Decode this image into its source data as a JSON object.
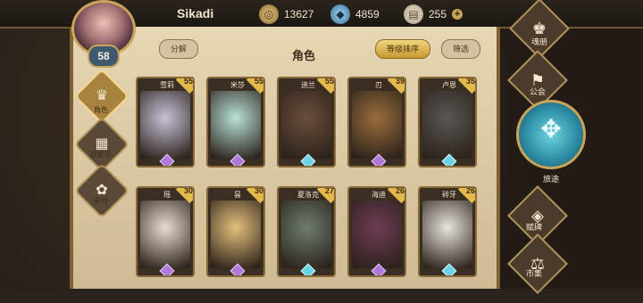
{
  "player": {
    "name": "Sikadi",
    "level": "58"
  },
  "currencies": [
    {
      "icon": "gold-coin-icon",
      "value": "13627"
    },
    {
      "icon": "blue-crystal-icon",
      "value": "4859"
    },
    {
      "icon": "scroll-icon",
      "value": "255"
    }
  ],
  "panel": {
    "title": "角色",
    "decompose_label": "分解",
    "sort_label": "等级排序",
    "filter_label": "筛选"
  },
  "side_tabs": [
    {
      "label": "角色",
      "icon": "crown-icon",
      "active": true
    },
    {
      "label": "技能书",
      "icon": "book-icon",
      "active": false
    },
    {
      "label": "素材",
      "icon": "pouch-icon",
      "active": false
    }
  ],
  "right_menu": [
    {
      "label": "魂册",
      "icon": "crown-icon"
    },
    {
      "label": "公会",
      "icon": "guild-flag-icon"
    },
    {
      "label": "旅途",
      "icon": "compass-icon"
    },
    {
      "label": "赋碑",
      "icon": "stone-icon"
    },
    {
      "label": "市集",
      "icon": "market-icon"
    }
  ],
  "heroes": [
    {
      "name": "雪莉",
      "level": "55",
      "gem": "purple",
      "art": "#c9c2d8"
    },
    {
      "name": "米莎",
      "level": "55",
      "gem": "purple",
      "art": "#b9e1d7"
    },
    {
      "name": "迪兰",
      "level": "55",
      "gem": "cyan",
      "art": "#6a4e3a"
    },
    {
      "name": "刃",
      "level": "39",
      "gem": "purple",
      "art": "#9a6e3c"
    },
    {
      "name": "卢恩",
      "level": "35",
      "gem": "cyan",
      "art": "#5b5754"
    },
    {
      "name": "瑶",
      "level": "30",
      "gem": "purple",
      "art": "#e8ddd0"
    },
    {
      "name": "昙",
      "level": "30",
      "gem": "purple",
      "art": "#e4c07b"
    },
    {
      "name": "夏洛克",
      "level": "27",
      "gem": "cyan",
      "art": "#6d7d6e"
    },
    {
      "name": "海迪",
      "level": "26",
      "gem": "purple",
      "art": "#6e3c55"
    },
    {
      "name": "碎牙",
      "level": "26",
      "gem": "cyan",
      "art": "#e9e5de"
    }
  ]
}
